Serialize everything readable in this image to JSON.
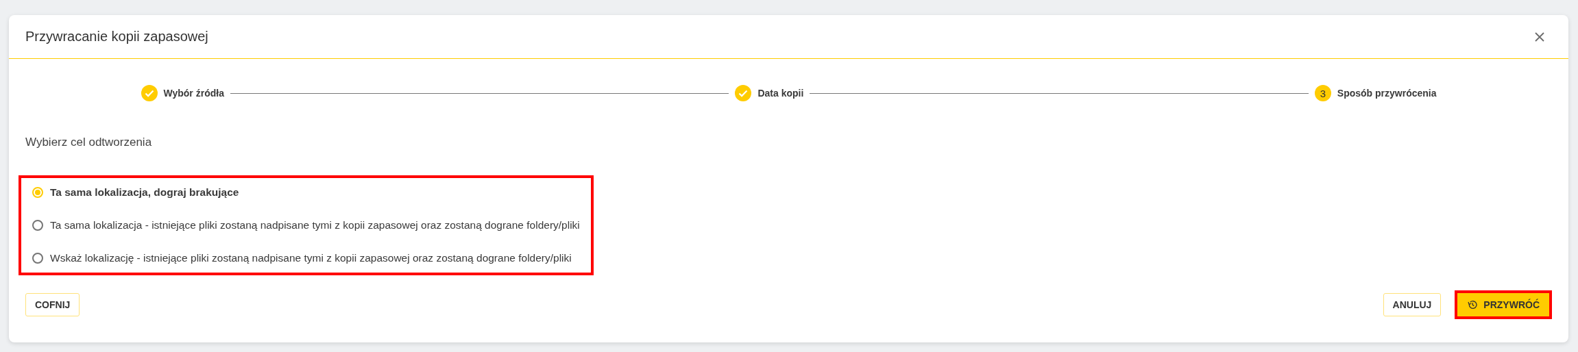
{
  "dialog": {
    "title": "Przywracanie kopii zapasowej"
  },
  "steps": [
    {
      "label": "Wybór źródła",
      "done": true
    },
    {
      "label": "Data kopii",
      "done": true
    },
    {
      "label": "Sposób przywrócenia",
      "number": "3",
      "done": false
    }
  ],
  "prompt": "Wybierz cel odtworzenia",
  "options": {
    "highlighted": true,
    "items": [
      {
        "label": "Ta sama lokalizacja, dograj brakujące",
        "selected": true
      },
      {
        "label": "Ta sama lokalizacja - istniejące pliki zostaną nadpisane tymi z kopii zapasowej oraz zostaną dograne foldery/pliki",
        "selected": false
      },
      {
        "label": "Wskaż lokalizację - istniejące pliki zostaną nadpisane tymi z kopii zapasowej oraz zostaną dograne foldery/pliki",
        "selected": false
      }
    ]
  },
  "buttons": [
    {
      "label": "COFNIJ",
      "kind": "outline",
      "highlighted": false
    },
    {
      "label": "ANULUJ",
      "kind": "outline",
      "highlighted": false
    },
    {
      "label": "PRZYWRÓĆ",
      "kind": "primary",
      "highlighted": true
    }
  ]
}
